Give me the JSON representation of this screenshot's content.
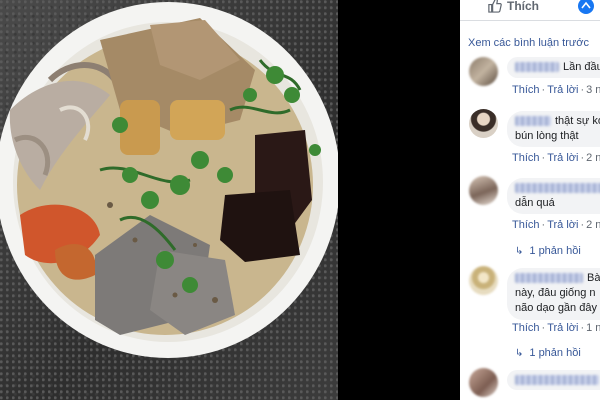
{
  "actions": {
    "like_label": "Thích"
  },
  "comments_panel": {
    "view_more_label": "Xem các bình luận trước",
    "comments": [
      {
        "text": "Lần đầu",
        "like": "Thích",
        "reply": "Trả lời",
        "time": "3 n"
      },
      {
        "text_line1": "thật sự ko",
        "text_line2": "bún lòng thật",
        "like": "Thích",
        "reply": "Trả lời",
        "time": "2 n"
      },
      {
        "text_line1": "dẫn quá",
        "like": "Thích",
        "reply": "Trả lời",
        "time": "2 n",
        "replies": "1 phản hồi"
      },
      {
        "text_line1": "Bài",
        "text_line2": "này, đâu giống n",
        "text_line3": "não dạo gần đây",
        "like": "Thích",
        "reply": "Trả lời",
        "time": "1 n",
        "replies": "1 phản hồi"
      }
    ]
  },
  "colors": {
    "link": "#385898",
    "bubble": "#f2f3f5",
    "action_text": "#606770"
  },
  "icons": [
    "thumbs-up-icon",
    "share-icon",
    "reply-arrow-icon"
  ]
}
